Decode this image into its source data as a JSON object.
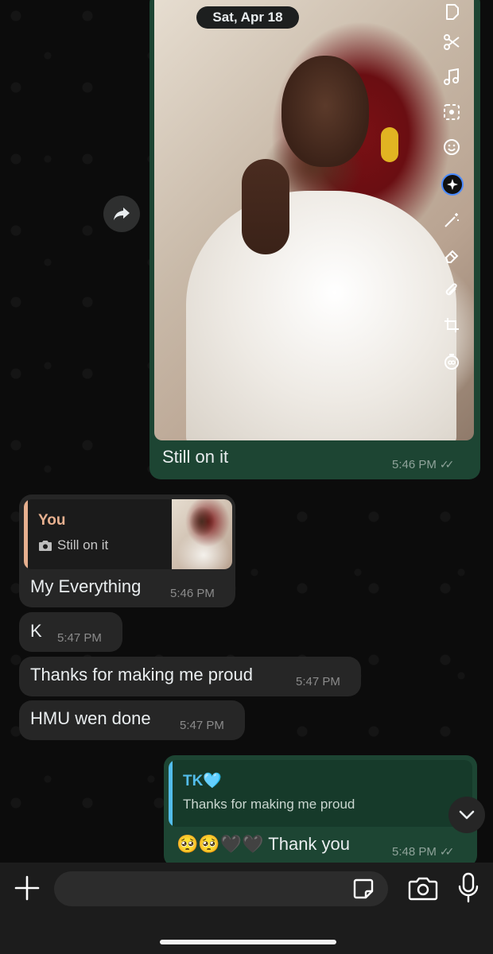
{
  "chat": {
    "date_label": "Sat, Apr 18",
    "outgoing_image": {
      "caption": "Still on it",
      "time": "5:46 PM",
      "edit_tools": [
        "crop-shape-icon",
        "scissors-icon",
        "music-icon",
        "cutout-icon",
        "emoji-icon",
        "ai-sparkle-icon",
        "magic-wand-icon",
        "eraser-icon",
        "paperclip-icon",
        "crop-icon",
        "timer-icon"
      ]
    },
    "reply_message": {
      "quote_author": "You",
      "quote_text": "Still on it",
      "text": "My Everything",
      "time": "5:46 PM"
    },
    "incoming": [
      {
        "text": "K",
        "time": "5:47 PM"
      },
      {
        "text": "Thanks for making me proud",
        "time": "5:47 PM"
      },
      {
        "text": "HMU wen done",
        "time": "5:47 PM"
      }
    ],
    "outgoing_reply": {
      "quote_author": "TK🩵",
      "quote_text": "Thanks for making me proud",
      "text": "🥺🥺🖤🖤 Thank you",
      "time": "5:48 PM"
    }
  },
  "input": {
    "placeholder": ""
  },
  "colors": {
    "outgoing_bubble": "#1d4533",
    "incoming_bubble": "#262626",
    "quote_you": "#e7b08f",
    "quote_tk": "#53bdeb"
  }
}
